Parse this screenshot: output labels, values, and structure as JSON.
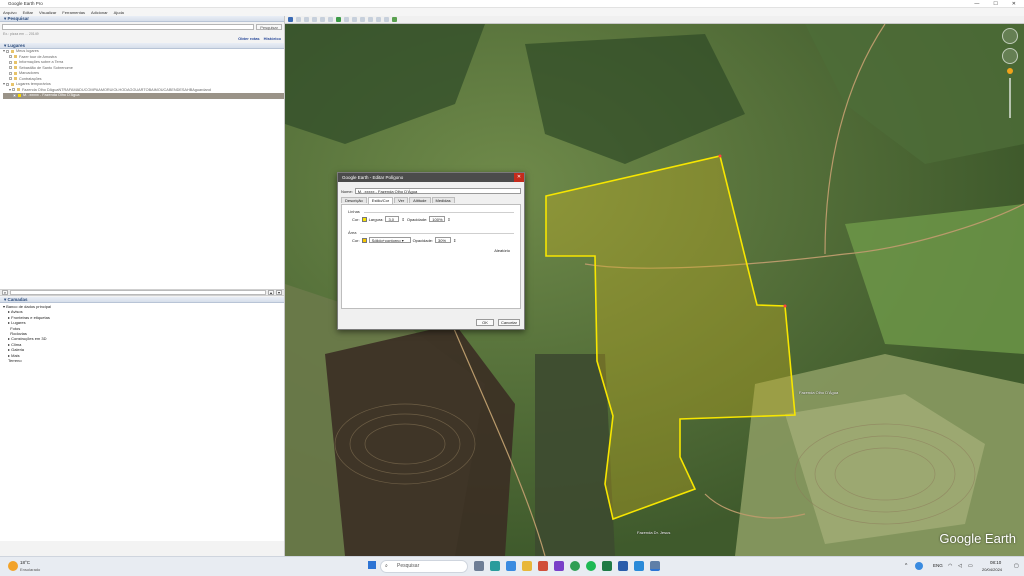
{
  "window": {
    "title": "Google Earth Pro",
    "controls": [
      "—",
      "☐",
      "✕"
    ]
  },
  "menu": [
    "Arquivo",
    "Editar",
    "Visualizar",
    "Ferramentas",
    "Adicionar",
    "Ajuda"
  ],
  "search": {
    "header": "Pesquisar",
    "placeholder": "",
    "button": "Pesquisar",
    "hint": "Ex.: pizza em ... 20149",
    "links": [
      "Obter rotas",
      "Histórico"
    ]
  },
  "places": {
    "header": "Lugares",
    "rows": [
      "Meus lugares",
      "Fazer tour de Amostra",
      "Informações sobre a Terra",
      "Sebastião de Santo Sobrenome",
      "Marcadores",
      "Contratações",
      "Lugares temporários",
      "Fazenda Olho DAguaNTRAFAMADUCOMPAAMORUIOLHODAGGUARTOBAIMOUCABENDESAHBAguardand",
      "M. .xxxxx - Fazenda Olho D'Água"
    ]
  },
  "layers": {
    "header": "Camadas",
    "rows": [
      "Banco de dados principal",
      "Avisos",
      "Fronteiras e etiquetas",
      "Lugares",
      "Fotos",
      "Rodovias",
      "Construções em 3D",
      "Clima",
      "Galeria",
      "Mais",
      "Terreno"
    ]
  },
  "dialog": {
    "title": "Google Earth - Editar Polígono",
    "name_label": "Nome:",
    "name_value": "M. .xxxxx - Fazenda Olho D'Água",
    "tabs": [
      "Descrição",
      "Estilo/Cor",
      "Ver",
      "Altitude",
      "Medidas"
    ],
    "active_tab": "Estilo/Cor",
    "lines_label": "Linhas",
    "line_color_label": "Cor:",
    "line_width_label": "Largura:",
    "line_width_value": "3,0",
    "line_opacity_label": "Opacidade:",
    "line_opacity_value": "100%",
    "area_label": "Área",
    "area_color_label": "Cor:",
    "area_fill_value": "Sólido+contorno",
    "area_opacity_label": "Opacidade:",
    "area_opacity_value": "30%",
    "random_button": "Aleatório",
    "ok": "OK",
    "cancel": "Cancelar",
    "line_color": "#f7e100",
    "area_color": "#f7c700"
  },
  "map": {
    "place_label": "Fazenda Olho D'Água",
    "bottom_label": "Fazenda Dr. Jesus",
    "brand": "Google Earth",
    "polygon_color": "#f7e600"
  },
  "taskbar": {
    "weather_temp": "18°C",
    "weather_text": "Ensolarado",
    "search_placeholder": "Pesquisar",
    "lang": "ENG",
    "time": "08:10",
    "date": "20/04/2024"
  }
}
